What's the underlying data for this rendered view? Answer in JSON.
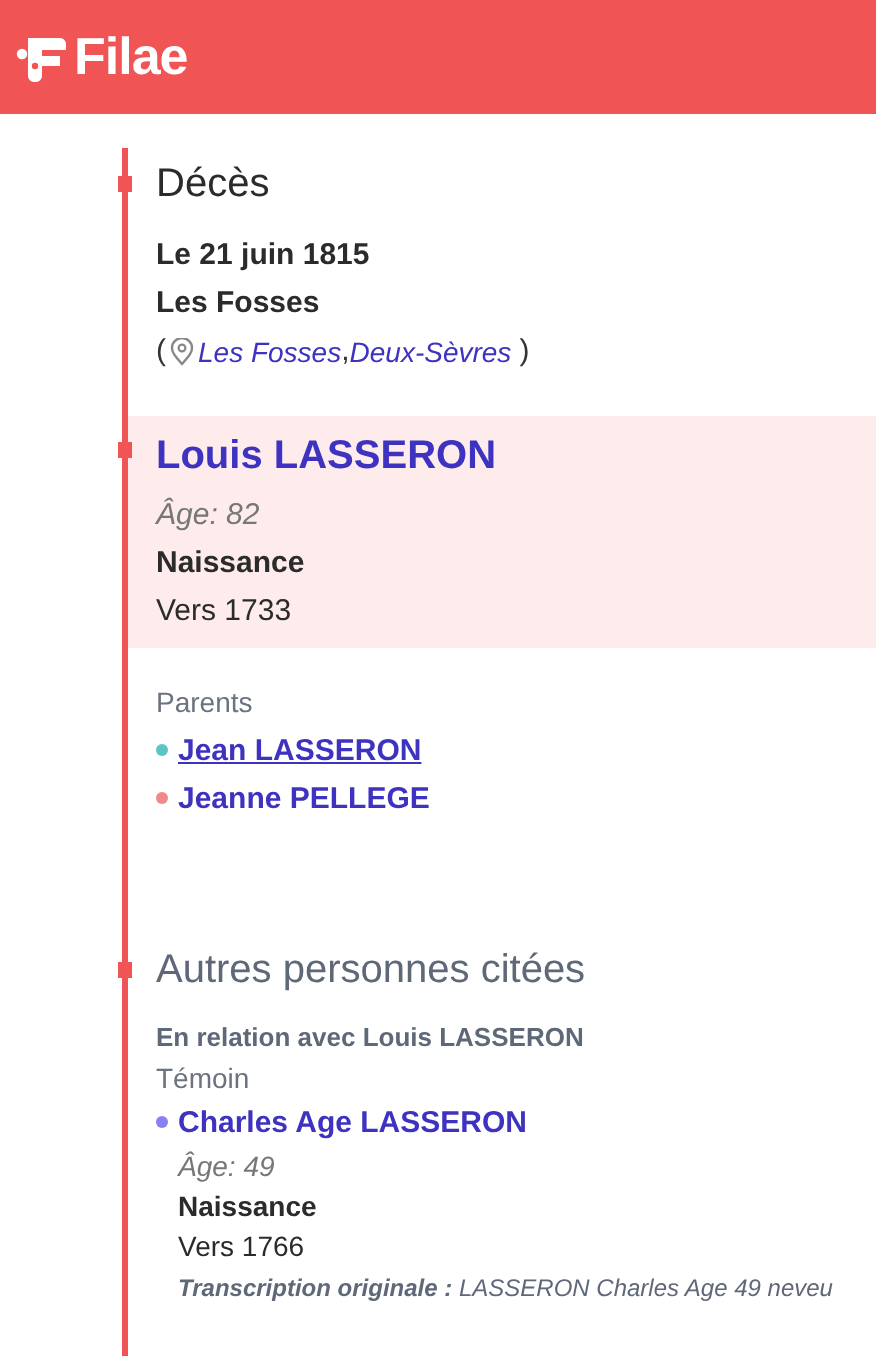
{
  "brand": {
    "name": "Filae"
  },
  "death": {
    "title": "Décès",
    "date": "Le 21 juin 1815",
    "place": "Les Fosses",
    "location": {
      "open": "(",
      "links": [
        "Les Fosses",
        "Deux-Sèvres"
      ],
      "separator": ",",
      "close": ")"
    }
  },
  "person": {
    "highlighted": true,
    "name": "Louis LASSERON",
    "age": "Âge: 82",
    "birth_label": "Naissance",
    "birth_date": "Vers 1733",
    "parents_label": "Parents",
    "parents": [
      {
        "name": "Jean LASSERON",
        "color": "#5bc4c4",
        "hovered": true
      },
      {
        "name": "Jeanne PELLEGE",
        "color": "#f08a8a",
        "hovered": false
      }
    ]
  },
  "others": {
    "title": "Autres personnes citées",
    "relation": "En relation avec Louis LASSERON",
    "role": "Témoin",
    "people": [
      {
        "name": "Charles Age LASSERON",
        "color": "#8a80f0",
        "age": "Âge: 49",
        "birth_label": "Naissance",
        "birth_date": "Vers 1766",
        "transcription_label": "Transcription originale :",
        "transcription": "LASSERON Charles Age 49 neveu"
      }
    ]
  }
}
